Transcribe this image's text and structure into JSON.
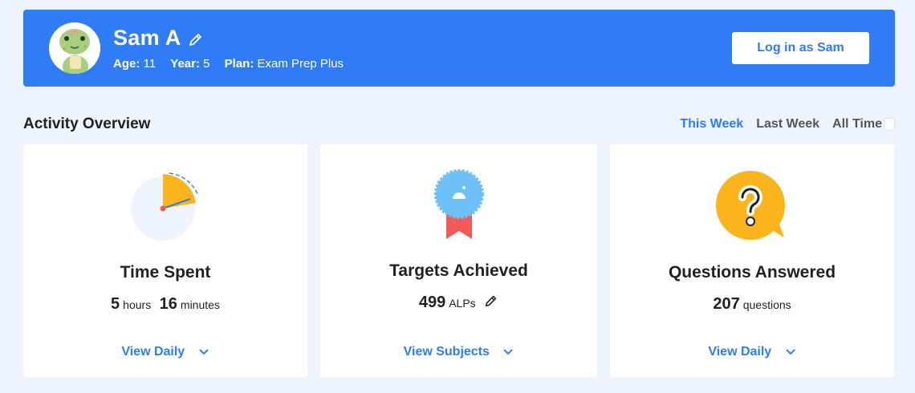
{
  "student": {
    "name": "Sam A",
    "age_label": "Age:",
    "age": "11",
    "year_label": "Year:",
    "year": "5",
    "plan_label": "Plan:",
    "plan": "Exam Prep Plus",
    "login_label": "Log in as Sam"
  },
  "activity": {
    "title": "Activity Overview",
    "tabs": [
      {
        "label": "This Week",
        "active": true
      },
      {
        "label": "Last Week",
        "active": false
      },
      {
        "label": "All Time",
        "active": false
      }
    ]
  },
  "cards": [
    {
      "title": "Time Spent",
      "hours": "5",
      "hours_unit": "hours",
      "minutes": "16",
      "minutes_unit": "minutes",
      "link": "View Daily",
      "icon": "clock-pie-icon"
    },
    {
      "title": "Targets Achieved",
      "value": "499",
      "unit": "ALPs",
      "link": "View Subjects",
      "icon": "award-ribbon-icon"
    },
    {
      "title": "Questions Answered",
      "value": "207",
      "unit": "questions",
      "link": "View Daily",
      "icon": "question-bubble-icon"
    }
  ],
  "colors": {
    "brand_blue": "#2f7cf6",
    "page_bg": "#eef4fd",
    "amber": "#fbb41c",
    "ribbon_red": "#f25a5a",
    "badge_blue": "#6ec1f7"
  }
}
